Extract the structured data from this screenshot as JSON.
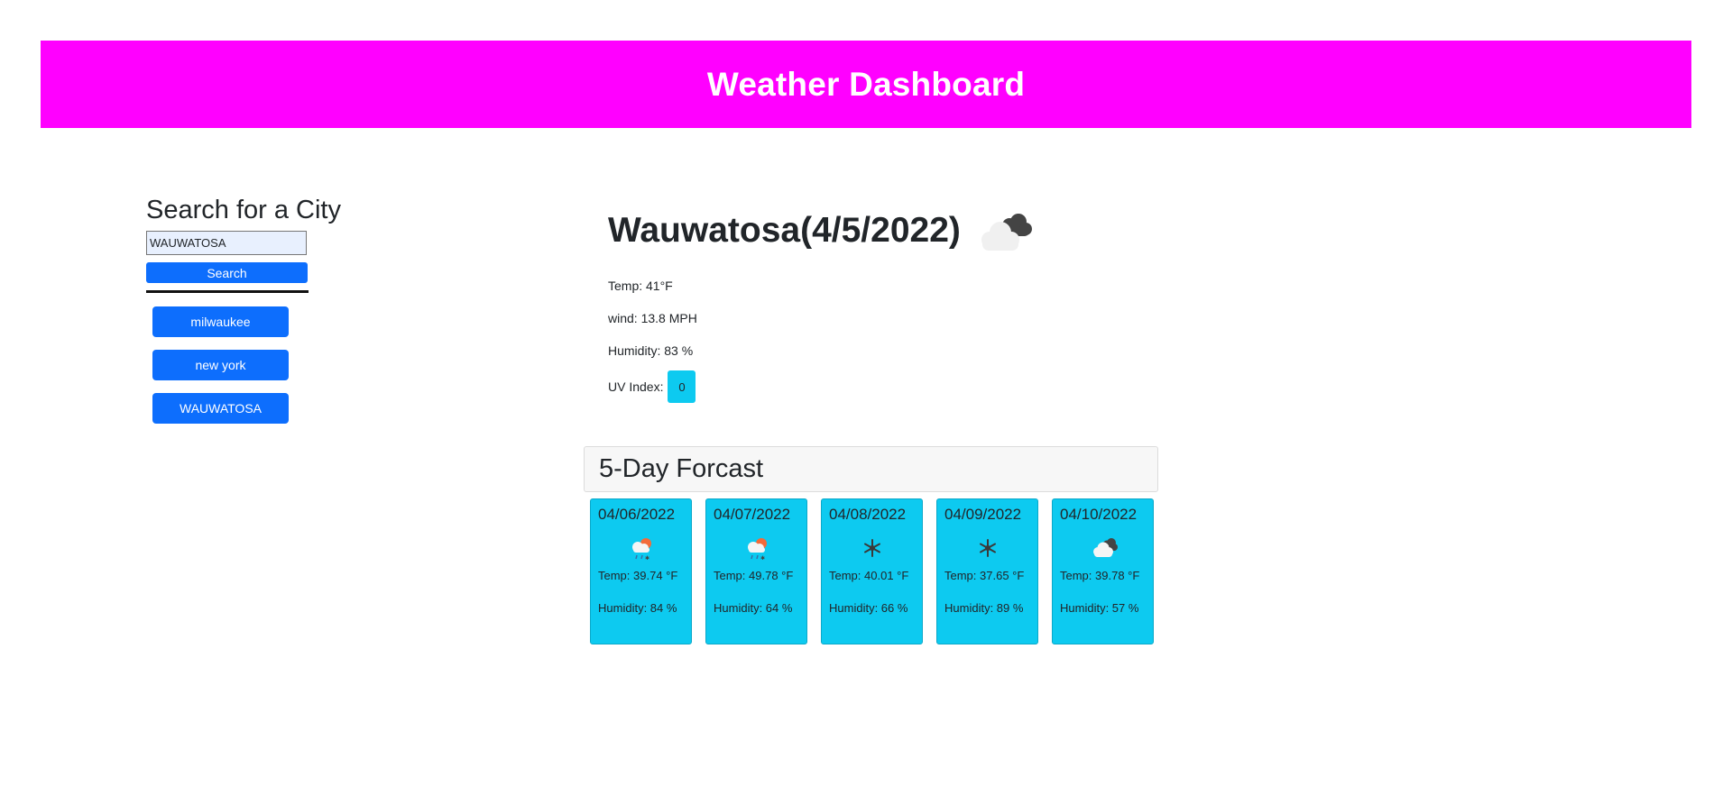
{
  "header": {
    "title": "Weather Dashboard"
  },
  "search": {
    "title": "Search for a City",
    "input_value": "WAUWATOSA",
    "button_label": "Search",
    "history": [
      "milwaukee",
      "new york",
      "WAUWATOSA"
    ]
  },
  "current": {
    "title": "Wauwatosa(4/5/2022)",
    "icon": "clouds-icon",
    "temp": "Temp: 41°F",
    "wind": "wind: 13.8 MPH",
    "humidity": "Humidity: 83 %",
    "uv_label": "UV Index:",
    "uv_value": "0",
    "uv_color": "#0dcaf0"
  },
  "forecast": {
    "title": "5-Day Forcast",
    "days": [
      {
        "date": "04/06/2022",
        "icon": "rain-snow-icon",
        "temp": "Temp: 39.74 °F",
        "humidity": "Humidity: 84 %"
      },
      {
        "date": "04/07/2022",
        "icon": "rain-snow-icon",
        "temp": "Temp: 49.78 °F",
        "humidity": "Humidity: 64 %"
      },
      {
        "date": "04/08/2022",
        "icon": "snowflake-icon",
        "temp": "Temp: 40.01 °F",
        "humidity": "Humidity: 66 %"
      },
      {
        "date": "04/09/2022",
        "icon": "snowflake-icon",
        "temp": "Temp: 37.65 °F",
        "humidity": "Humidity: 89 %"
      },
      {
        "date": "04/10/2022",
        "icon": "clouds-icon",
        "temp": "Temp: 39.78 °F",
        "humidity": "Humidity: 57 %"
      }
    ]
  },
  "colors": {
    "header": "#ff00ff",
    "button": "#0d6efd",
    "card": "#0dcaf0"
  }
}
